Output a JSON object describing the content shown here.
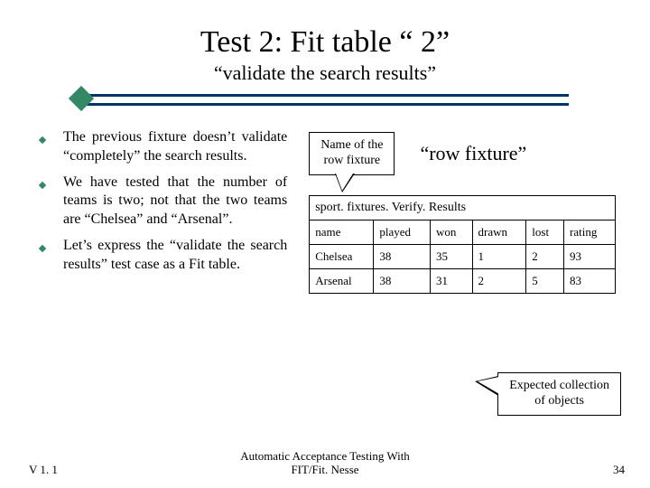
{
  "title": "Test 2: Fit table “ 2”",
  "subtitle": "“validate the search results”",
  "bullets": [
    "The previous fixture doesn’t validate “completely” the search results.",
    "We have tested that the number of teams is two; not that the two teams are “Chelsea” and “Arsenal”.",
    "Let’s express the “validate the search results” test case as a Fit table."
  ],
  "callout_top": "Name of the\nrow fixture",
  "row_fixture_label": "“row fixture”",
  "fit_table": {
    "fixture_name": "sport. fixtures. Verify. Results",
    "headers": [
      "name",
      "played",
      "won",
      "drawn",
      "lost",
      "rating"
    ],
    "rows": [
      [
        "Chelsea",
        "38",
        "35",
        "1",
        "2",
        "93"
      ],
      [
        "Arsenal",
        "38",
        "31",
        "2",
        "5",
        "83"
      ]
    ]
  },
  "callout_bottom": "Expected collection\nof objects",
  "footer": {
    "version": "V 1. 1",
    "center": "Automatic Acceptance Testing With\nFIT/Fit. Nesse",
    "page": "34"
  },
  "chart_data": {
    "type": "table",
    "title": "sport.fixtures.Verify.Results (Fit row-fixture table)",
    "headers": [
      "name",
      "played",
      "won",
      "drawn",
      "lost",
      "rating"
    ],
    "rows": [
      {
        "name": "Chelsea",
        "played": 38,
        "won": 35,
        "drawn": 1,
        "lost": 2,
        "rating": 93
      },
      {
        "name": "Arsenal",
        "played": 38,
        "won": 31,
        "drawn": 2,
        "lost": 5,
        "rating": 83
      }
    ]
  }
}
